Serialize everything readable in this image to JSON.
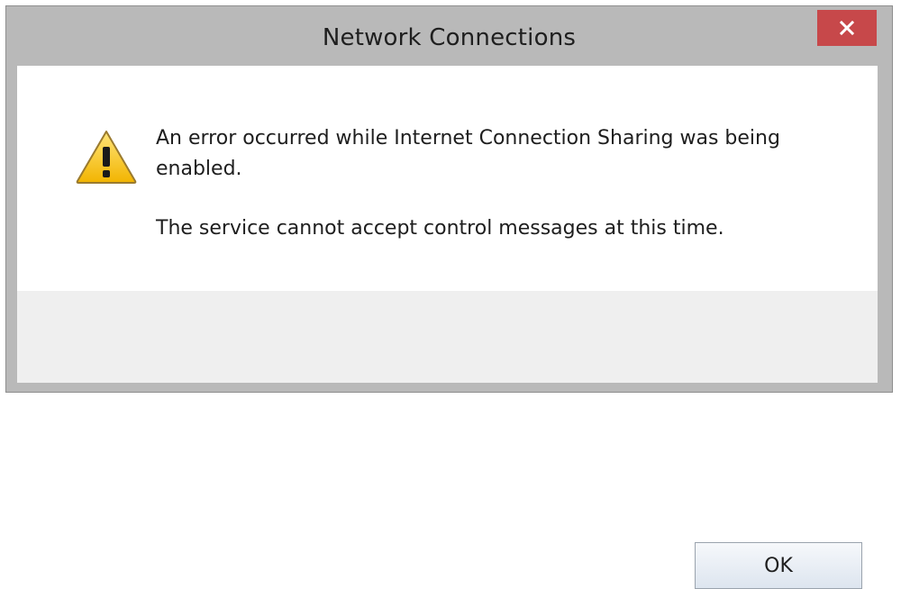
{
  "window": {
    "title": "Network Connections",
    "close_icon": "close-icon",
    "accent_close_color": "#c7484a"
  },
  "dialog": {
    "icon": "warning-icon",
    "message_line1": "An error occurred while Internet Connection Sharing was being enabled.",
    "message_line2": "The service cannot accept control messages at this time."
  },
  "buttons": {
    "ok_label": "OK"
  }
}
